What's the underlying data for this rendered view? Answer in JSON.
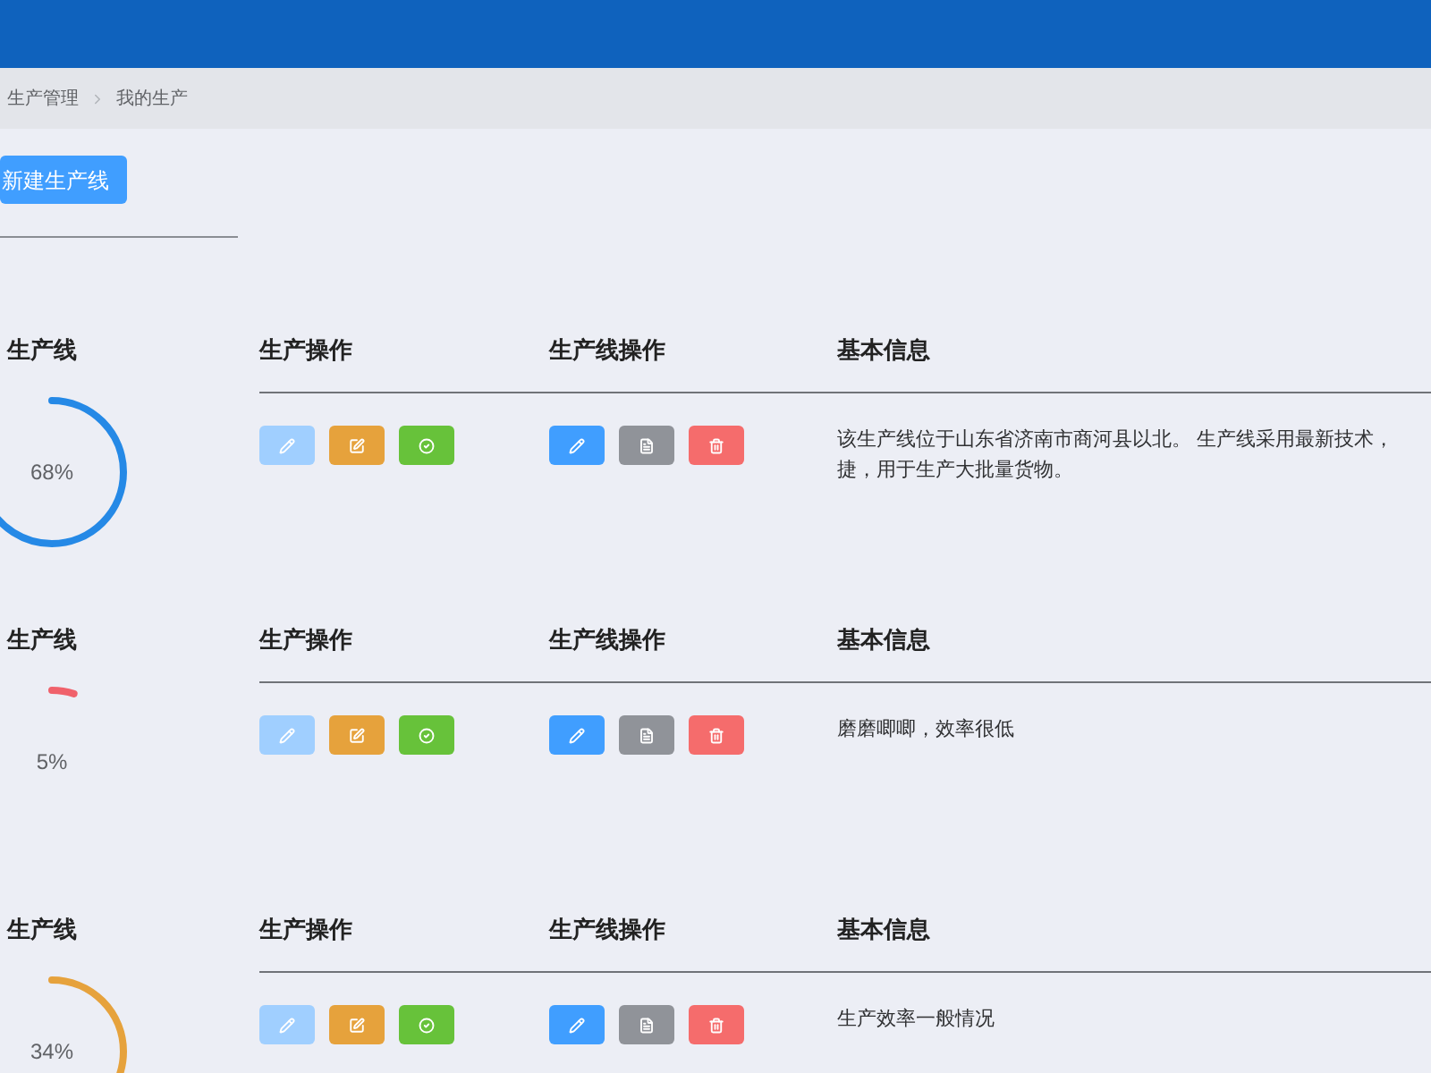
{
  "breadcrumb": [
    "生产管理",
    "我的生产"
  ],
  "new_button": "新建生产线",
  "sections": [
    {
      "title": "生产线",
      "level": 0.68,
      "percent": "68%",
      "color": "#2589e6",
      "headers": [
        "生产操作",
        "生产线操作",
        "基本信息"
      ],
      "production_ops": [
        {
          "kind": "pencil",
          "disabled": true
        },
        {
          "kind": "edit",
          "disabled": false
        },
        {
          "kind": "check",
          "disabled": false
        }
      ],
      "line_ops": [
        {
          "kind": "pencil"
        },
        {
          "kind": "file"
        },
        {
          "kind": "trash"
        }
      ],
      "info_lines": [
        "该生产线位于山东省济南市商河县以北。 生产线采用最新技术，",
        "捷，用于生产大批量货物。"
      ]
    },
    {
      "title": "生产线",
      "level": 0.05,
      "percent": "5%",
      "color": "#f0616b",
      "headers": [
        "生产操作",
        "生产线操作",
        "基本信息"
      ],
      "production_ops": [
        {
          "kind": "pencil",
          "disabled": true
        },
        {
          "kind": "edit",
          "disabled": false
        },
        {
          "kind": "check",
          "disabled": false
        }
      ],
      "line_ops": [
        {
          "kind": "pencil"
        },
        {
          "kind": "file"
        },
        {
          "kind": "trash"
        }
      ],
      "info_lines": [
        "磨磨唧唧，效率很低"
      ]
    },
    {
      "title": "生产线",
      "level": 0.34,
      "percent": "34%",
      "color": "#e6a23c",
      "headers": [
        "生产操作",
        "生产线操作",
        "基本信息"
      ],
      "production_ops": [
        {
          "kind": "pencil",
          "disabled": true
        },
        {
          "kind": "edit",
          "disabled": false
        },
        {
          "kind": "check",
          "disabled": false
        }
      ],
      "line_ops": [
        {
          "kind": "pencil"
        },
        {
          "kind": "file"
        },
        {
          "kind": "trash"
        }
      ],
      "info_lines": [
        "生产效率一般情况"
      ]
    }
  ]
}
